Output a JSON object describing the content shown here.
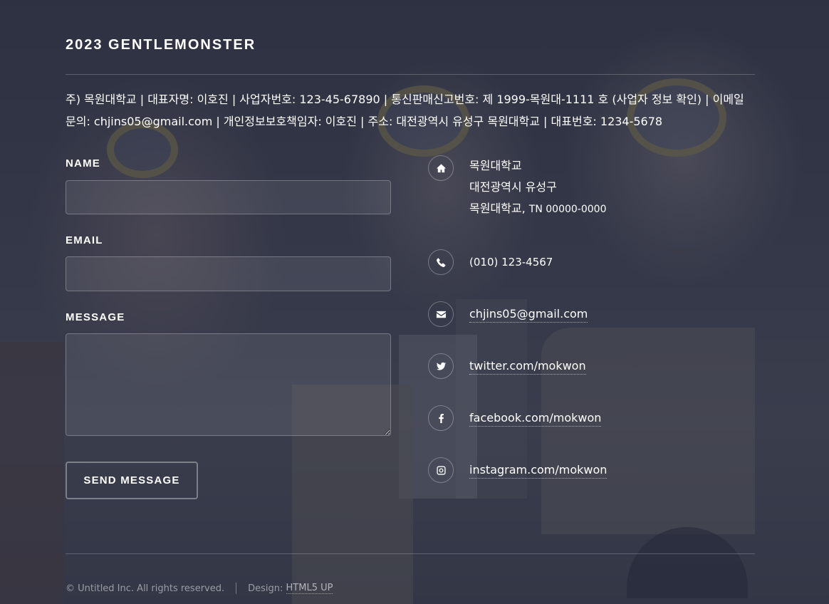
{
  "header": {
    "brand": "2023 GENTLEMONSTER",
    "info": "주) 목원대학교 | 대표자명: 이호진 | 사업자번호: 123-45-67890 | 통신판매신고번호: 제 1999-목원대-1111 호 (사업자 정보 확인) | 이메일 문의: chjins05@gmail.com | 개인정보보호책임자: 이호진 | 주소: 대전광역시 유성구 목원대학교 | 대표번호: 1234-5678"
  },
  "form": {
    "name_label": "NAME",
    "email_label": "EMAIL",
    "message_label": "MESSAGE",
    "name_value": "",
    "email_value": "",
    "message_value": "",
    "send_label": "SEND MESSAGE"
  },
  "contact": {
    "address_line1": "목원대학교",
    "address_line2": "대전광역시 유성구",
    "address_line3": "목원대학교,",
    "address_zip": "TN 00000-0000",
    "phone": "(010) 123-4567",
    "email": "chjins05@gmail.com",
    "twitter": "twitter.com/mokwon",
    "facebook": "facebook.com/mokwon",
    "instagram": "instagram.com/mokwon",
    "icons": [
      "home-icon",
      "phone-icon",
      "envelope-icon",
      "twitter-icon",
      "facebook-icon",
      "instagram-icon"
    ]
  },
  "footer": {
    "copyright": "© Untitled Inc. All rights reserved.",
    "design_label": "Design:",
    "design_link": "HTML5 UP"
  }
}
